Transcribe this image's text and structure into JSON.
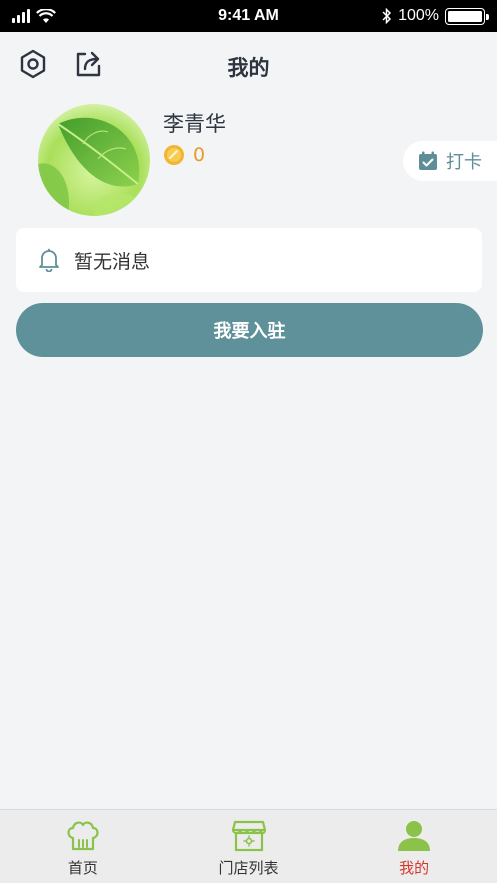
{
  "status_bar": {
    "time": "9:41 AM",
    "battery": "100%"
  },
  "header": {
    "title": "我的",
    "settings_icon": "settings-hexagon-icon",
    "share_icon": "share-icon"
  },
  "profile": {
    "name": "李青华",
    "coins": "0",
    "avatar": "leaf-photo"
  },
  "checkin": {
    "label": "打卡",
    "icon": "calendar-check-icon"
  },
  "message": {
    "text": "暂无消息",
    "icon": "bell-icon"
  },
  "join_button": {
    "label": "我要入驻"
  },
  "tabs": [
    {
      "label": "首页",
      "icon": "chef-hat-icon",
      "active": false
    },
    {
      "label": "门店列表",
      "icon": "store-icon",
      "active": false
    },
    {
      "label": "我的",
      "icon": "person-icon",
      "active": true
    }
  ],
  "colors": {
    "accent": "#5e9199",
    "tab_icon_green": "#8bc34a",
    "active_tab_label": "#d33a2c",
    "coin": "#e89a2c"
  }
}
